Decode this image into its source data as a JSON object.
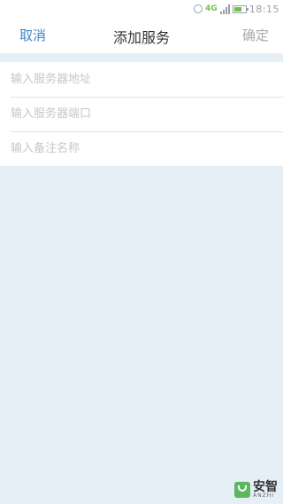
{
  "status_bar": {
    "network_label": "4G",
    "time": "18:15"
  },
  "nav": {
    "cancel_label": "取消",
    "title": "添加服务",
    "confirm_label": "确定"
  },
  "form": {
    "fields": [
      {
        "placeholder": "输入服务器地址",
        "value": ""
      },
      {
        "placeholder": "输入服务器端口",
        "value": ""
      },
      {
        "placeholder": "输入备注名称",
        "value": ""
      }
    ]
  },
  "watermark": {
    "brand_cn": "安智",
    "brand_en": "ANZHI"
  },
  "colors": {
    "accent": "#3f86c9",
    "disabled": "#a9a9a9",
    "background": "#e6eef6"
  }
}
